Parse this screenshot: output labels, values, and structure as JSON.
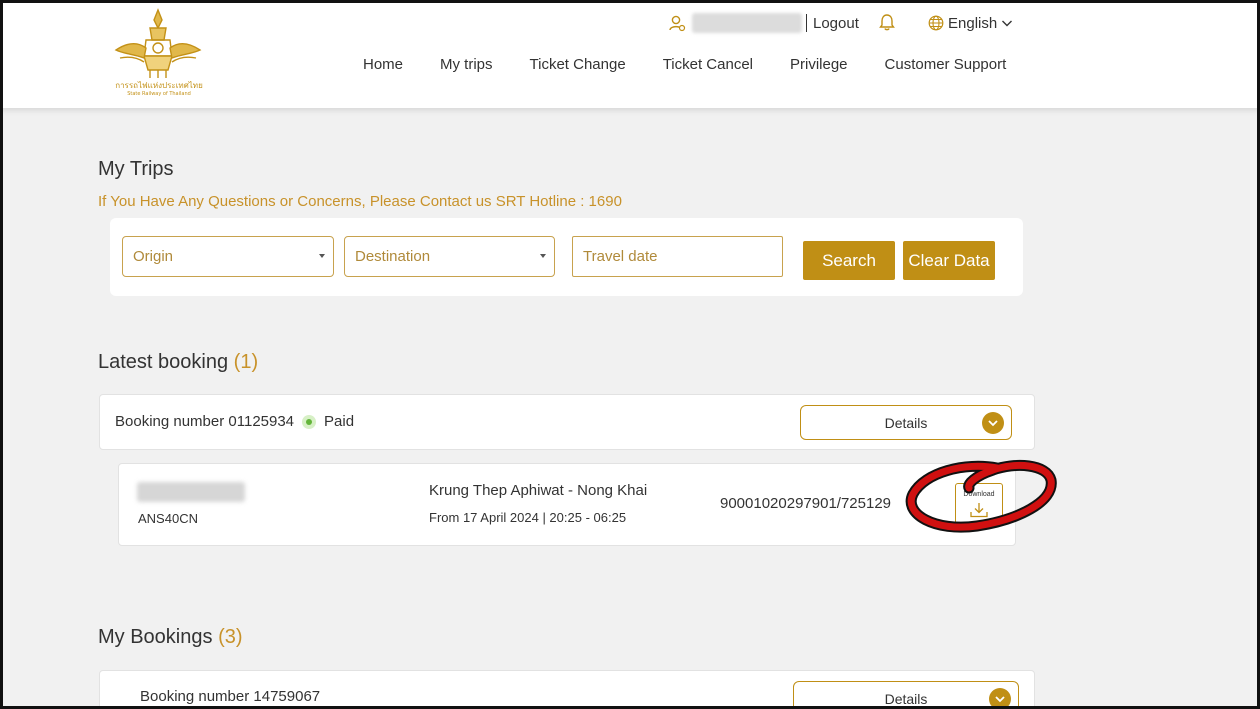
{
  "brand": {
    "logo_text_thai": "การรถไฟแห่งประเทศไทย",
    "logo_text_en": "State Railway of Thailand"
  },
  "topbar": {
    "logout_label": "Logout",
    "language_label": "English"
  },
  "nav": {
    "items": [
      {
        "label": "Home"
      },
      {
        "label": "My trips"
      },
      {
        "label": "Ticket Change"
      },
      {
        "label": "Ticket Cancel"
      },
      {
        "label": "Privilege"
      },
      {
        "label": "Customer Support"
      }
    ]
  },
  "page": {
    "title": "My Trips",
    "hotline": "If You Have Any Questions or Concerns, Please Contact us SRT Hotline : 1690"
  },
  "search": {
    "origin_placeholder": "Origin",
    "destination_placeholder": "Destination",
    "travel_date_placeholder": "Travel date",
    "search_label": "Search",
    "clear_label": "Clear Data"
  },
  "latest": {
    "title": "Latest booking",
    "count": "(1)",
    "booking_number": "Booking number 01125934",
    "status": "Paid",
    "details_label": "Details",
    "ticket": {
      "code": "ANS40CN",
      "route": "Krung Thep Aphiwat - Nong Khai",
      "when": "From 17 April 2024 | 20:25 - 06:25",
      "reference": "90001020297901/725129",
      "download_label": "Download"
    }
  },
  "my_bookings": {
    "title": "My Bookings",
    "count": "(3)",
    "first_booking_number": "Booking number 14759067",
    "details_label": "Details"
  },
  "colors": {
    "accent": "#c08f15",
    "accent_text": "#c8922a",
    "paid_green": "#63b53a",
    "annotation_red": "#d01010"
  }
}
